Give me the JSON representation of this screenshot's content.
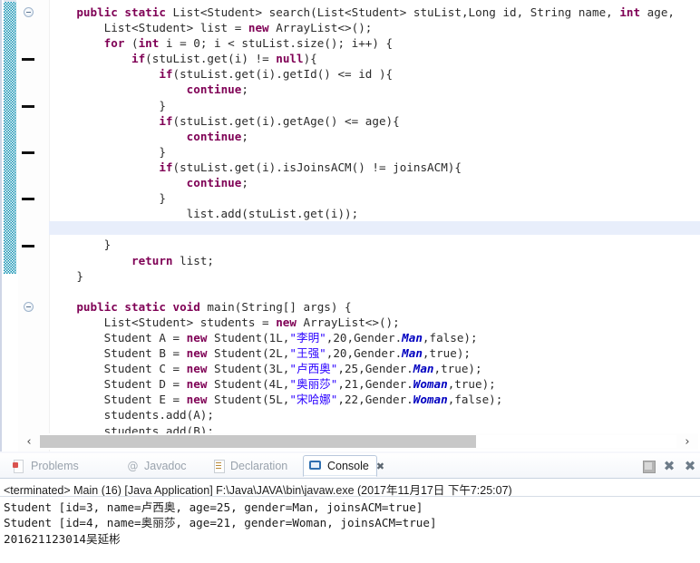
{
  "editor": {
    "name": "java-source-editor",
    "language": "Java",
    "current_line_index": 14,
    "lines": [
      [
        {
          "t": "    ",
          "c": "pl"
        },
        {
          "t": "public static ",
          "c": "kw"
        },
        {
          "t": "List<Student> search(List<Student> stuList,Long id, String name, ",
          "c": "pl"
        },
        {
          "t": "int",
          "c": "kw"
        },
        {
          "t": " age,",
          "c": "pl"
        }
      ],
      [
        {
          "t": "        List<Student> list = ",
          "c": "pl"
        },
        {
          "t": "new",
          "c": "kw"
        },
        {
          "t": " ArrayList<>();",
          "c": "pl"
        }
      ],
      [
        {
          "t": "        ",
          "c": "pl"
        },
        {
          "t": "for",
          "c": "kw"
        },
        {
          "t": " (",
          "c": "pl"
        },
        {
          "t": "int",
          "c": "kw"
        },
        {
          "t": " i = 0; i < stuList.size(); i++) {",
          "c": "pl"
        }
      ],
      [
        {
          "t": "            ",
          "c": "pl"
        },
        {
          "t": "if",
          "c": "kw"
        },
        {
          "t": "(stuList.get(i) != ",
          "c": "pl"
        },
        {
          "t": "null",
          "c": "kw"
        },
        {
          "t": "){",
          "c": "pl"
        }
      ],
      [
        {
          "t": "                ",
          "c": "pl"
        },
        {
          "t": "if",
          "c": "kw"
        },
        {
          "t": "(stuList.get(i).getId() <= id ){",
          "c": "pl"
        }
      ],
      [
        {
          "t": "                    ",
          "c": "pl"
        },
        {
          "t": "continue",
          "c": "kw"
        },
        {
          "t": ";",
          "c": "pl"
        }
      ],
      [
        {
          "t": "                }",
          "c": "pl"
        }
      ],
      [
        {
          "t": "                ",
          "c": "pl"
        },
        {
          "t": "if",
          "c": "kw"
        },
        {
          "t": "(stuList.get(i).getAge() <= age){",
          "c": "pl"
        }
      ],
      [
        {
          "t": "                    ",
          "c": "pl"
        },
        {
          "t": "continue",
          "c": "kw"
        },
        {
          "t": ";",
          "c": "pl"
        }
      ],
      [
        {
          "t": "                }",
          "c": "pl"
        }
      ],
      [
        {
          "t": "                ",
          "c": "pl"
        },
        {
          "t": "if",
          "c": "kw"
        },
        {
          "t": "(stuList.get(i).isJoinsACM() != joinsACM){",
          "c": "pl"
        }
      ],
      [
        {
          "t": "                    ",
          "c": "pl"
        },
        {
          "t": "continue",
          "c": "kw"
        },
        {
          "t": ";",
          "c": "pl"
        }
      ],
      [
        {
          "t": "                }",
          "c": "pl"
        }
      ],
      [
        {
          "t": "                    list.add(stuList.get(i));",
          "c": "pl"
        }
      ],
      [
        {
          "t": "            }",
          "c": "pl"
        }
      ],
      [
        {
          "t": "        }",
          "c": "pl"
        }
      ],
      [
        {
          "t": "            ",
          "c": "pl"
        },
        {
          "t": "return",
          "c": "kw"
        },
        {
          "t": " list;",
          "c": "pl"
        }
      ],
      [
        {
          "t": "    }",
          "c": "pl"
        }
      ],
      [
        {
          "t": "",
          "c": "pl"
        }
      ],
      [
        {
          "t": "    ",
          "c": "pl"
        },
        {
          "t": "public static void ",
          "c": "kw"
        },
        {
          "t": "main(String[] args) {",
          "c": "pl"
        }
      ],
      [
        {
          "t": "        List<Student> students = ",
          "c": "pl"
        },
        {
          "t": "new",
          "c": "kw"
        },
        {
          "t": " ArrayList<>();",
          "c": "pl"
        }
      ],
      [
        {
          "t": "        Student A = ",
          "c": "pl"
        },
        {
          "t": "new",
          "c": "kw"
        },
        {
          "t": " Student(1L,",
          "c": "pl"
        },
        {
          "t": "\"李明\"",
          "c": "str"
        },
        {
          "t": ",20,Gender.",
          "c": "pl"
        },
        {
          "t": "Man",
          "c": "stfld"
        },
        {
          "t": ",false);",
          "c": "pl"
        }
      ],
      [
        {
          "t": "        Student B = ",
          "c": "pl"
        },
        {
          "t": "new",
          "c": "kw"
        },
        {
          "t": " Student(2L,",
          "c": "pl"
        },
        {
          "t": "\"王强\"",
          "c": "str"
        },
        {
          "t": ",20,Gender.",
          "c": "pl"
        },
        {
          "t": "Man",
          "c": "stfld"
        },
        {
          "t": ",true);",
          "c": "pl"
        }
      ],
      [
        {
          "t": "        Student C = ",
          "c": "pl"
        },
        {
          "t": "new",
          "c": "kw"
        },
        {
          "t": " Student(3L,",
          "c": "pl"
        },
        {
          "t": "\"卢西奥\"",
          "c": "str"
        },
        {
          "t": ",25,Gender.",
          "c": "pl"
        },
        {
          "t": "Man",
          "c": "stfld"
        },
        {
          "t": ",true);",
          "c": "pl"
        }
      ],
      [
        {
          "t": "        Student D = ",
          "c": "pl"
        },
        {
          "t": "new",
          "c": "kw"
        },
        {
          "t": " Student(4L,",
          "c": "pl"
        },
        {
          "t": "\"奥丽莎\"",
          "c": "str"
        },
        {
          "t": ",21,Gender.",
          "c": "pl"
        },
        {
          "t": "Woman",
          "c": "stfld"
        },
        {
          "t": ",true);",
          "c": "pl"
        }
      ],
      [
        {
          "t": "        Student E = ",
          "c": "pl"
        },
        {
          "t": "new",
          "c": "kw"
        },
        {
          "t": " Student(5L,",
          "c": "pl"
        },
        {
          "t": "\"宋哈娜\"",
          "c": "str"
        },
        {
          "t": ",22,Gender.",
          "c": "pl"
        },
        {
          "t": "Woman",
          "c": "stfld"
        },
        {
          "t": ",false);",
          "c": "pl"
        }
      ],
      [
        {
          "t": "        students.add(A);",
          "c": "pl"
        }
      ],
      [
        {
          "t": "        students.add(B);",
          "c": "pl"
        }
      ]
    ],
    "fold_marker_rows": [
      0,
      19
    ],
    "breakpoint_rows": [
      3,
      6,
      9,
      12,
      15
    ],
    "hscroll": {
      "left_arrow": "‹",
      "right_arrow": "›",
      "thumb_ratio": 0.685
    }
  },
  "bottom_view": {
    "tabs": [
      {
        "label": "Problems",
        "icon": "problems-icon",
        "active": false
      },
      {
        "label": "Javadoc",
        "icon": "javadoc-icon",
        "active": false
      },
      {
        "label": "Declaration",
        "icon": "declaration-icon",
        "active": false
      },
      {
        "label": "Console",
        "icon": "console-icon",
        "active": true,
        "close_glyph": "✖"
      }
    ],
    "toolbar": [
      {
        "name": "terminate-button",
        "glyph": ""
      },
      {
        "name": "remove-launch-button",
        "glyph": "✖"
      },
      {
        "name": "remove-all-terminated-button",
        "glyph": "✖"
      }
    ],
    "console": {
      "header": "<terminated> Main (16) [Java Application] F:\\Java\\JAVA\\bin\\javaw.exe (2017年11月17日 下午7:25:07)",
      "output": [
        "Student [id=3, name=卢西奥, age=25, gender=Man, joinsACM=true]",
        "Student [id=4, name=奥丽莎, age=21, gender=Woman, joinsACM=true]",
        "201621123014吴延彬"
      ]
    }
  },
  "colors": {
    "keyword": "#7f0055",
    "string": "#2a00ff",
    "static_field": "#0000c0",
    "current_line_highlight": "#e8eefb",
    "annotation_ruler": "#0e8fb0",
    "tab_active_text": "#1a1a1a",
    "tab_inactive_text": "#9aa3ad"
  }
}
